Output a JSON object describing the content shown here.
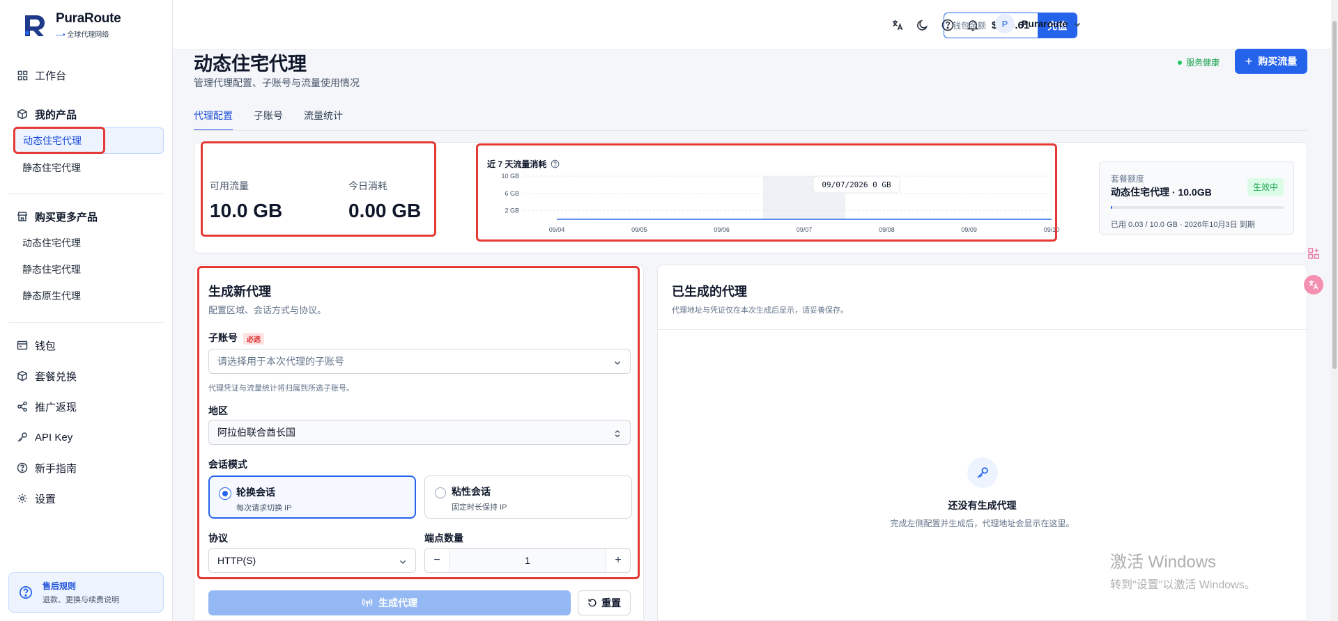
{
  "brand": {
    "name": "PuraRoute",
    "tagline": "全球代理网络"
  },
  "sidebar": {
    "dashboard": "工作台",
    "my_products": {
      "label": "我的产品",
      "items": [
        "动态住宅代理",
        "静态住宅代理"
      ]
    },
    "buy_more": {
      "label": "购买更多产品",
      "items": [
        "动态住宅代理",
        "静态住宅代理",
        "静态原生代理"
      ]
    },
    "wallet": "钱包",
    "package_exchange": "套餐兑换",
    "referral": "推广返现",
    "api_key": "API Key",
    "guide": "新手指南",
    "settings": "设置",
    "help": {
      "title": "售后规则",
      "subtitle": "退款、更换与续费说明"
    }
  },
  "header": {
    "wallet_label": "钱包余额",
    "wallet_amount": "$279.61",
    "recharge": "充值",
    "user_initial": "P",
    "user_name": "Puraroute"
  },
  "page": {
    "title": "动态住宅代理",
    "subtitle": "管理代理配置、子账号与流量使用情况",
    "health": "服务健康",
    "buy_button": "购买流量",
    "tabs": [
      "代理配置",
      "子账号",
      "流量统计"
    ]
  },
  "stats": {
    "available_label": "可用流量",
    "available_value": "10.0 GB",
    "today_label": "今日消耗",
    "today_value": "0.00 GB"
  },
  "chart_data": {
    "type": "area",
    "title": "近 7 天流量消耗",
    "x": [
      "09/04",
      "09/05",
      "09/06",
      "09/07",
      "09/08",
      "09/09",
      "09/10"
    ],
    "y_ticks": [
      "10 GB",
      "6 GB",
      "2 GB"
    ],
    "ylim": [
      0,
      10
    ],
    "series": [
      {
        "values": [
          0.03,
          0,
          0,
          0,
          0,
          0,
          0
        ]
      }
    ],
    "tooltip": "09/07/2026 0 GB",
    "highlight": "09/07"
  },
  "quota": {
    "label": "套餐额度",
    "name": "动态住宅代理 · 10.0GB",
    "status": "生效中",
    "used_fraction": 0.003,
    "footer": "已用 0.03 / 10.0 GB · 2026年10月3日 到期"
  },
  "generate": {
    "title": "生成新代理",
    "subtitle": "配置区域、会话方式与协议。",
    "subaccount_label": "子账号",
    "required": "必选",
    "subaccount_placeholder": "请选择用于本次代理的子账号",
    "subaccount_hint": "代理凭证与流量统计将归属到所选子账号。",
    "region_label": "地区",
    "region_value": "阿拉伯联合酋长国",
    "session_label": "会话模式",
    "sessions": [
      {
        "title": "轮换会话",
        "desc": "每次请求切换 IP",
        "selected": true
      },
      {
        "title": "粘性会话",
        "desc": "固定时长保持 IP",
        "selected": false
      }
    ],
    "protocol_label": "协议",
    "protocol_value": "HTTP(S)",
    "endpoints_label": "端点数量",
    "endpoints_value": "1",
    "generate_button": "生成代理",
    "reset_button": "重置"
  },
  "output": {
    "title": "已生成的代理",
    "subtitle": "代理地址与凭证仅在本次生成后显示，请妥善保存。",
    "empty_title": "还没有生成代理",
    "empty_desc": "完成左侧配置并生成后，代理地址会显示在这里。"
  },
  "watermark": {
    "line1": "激活 Windows",
    "line2": "转到\"设置\"以激活 Windows。"
  }
}
